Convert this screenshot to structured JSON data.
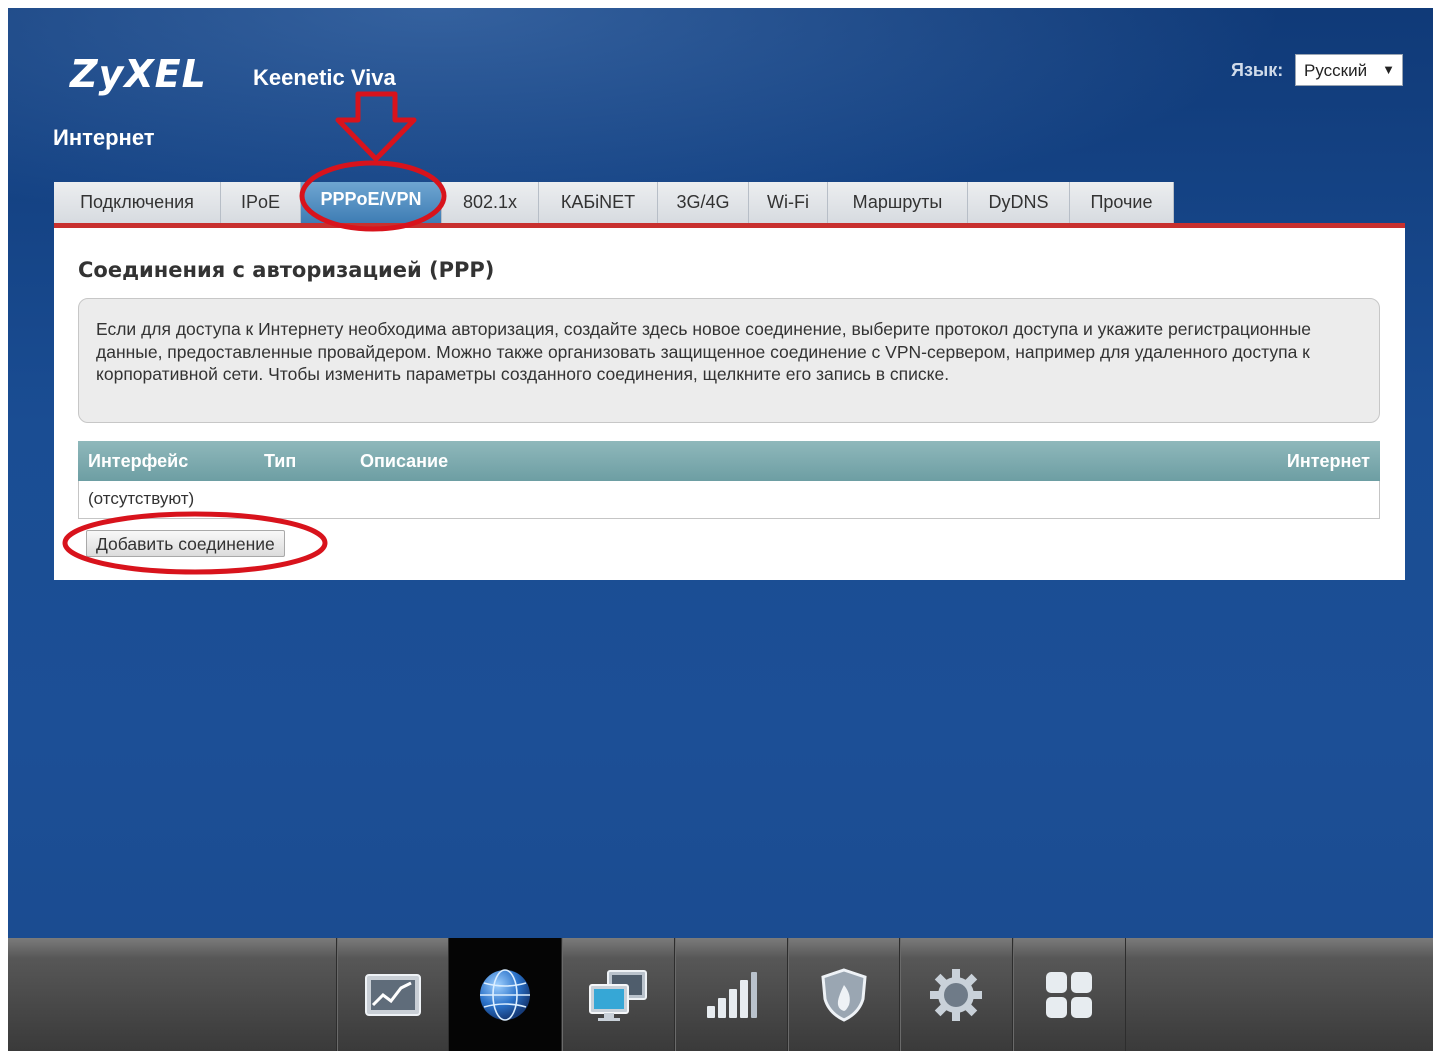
{
  "header": {
    "logo": "ZyXEL",
    "model": "Keenetic Viva",
    "page_title": "Интернет",
    "language_label": "Язык:",
    "language_value": "Русский",
    "language_arrow": "▼"
  },
  "tabs": [
    {
      "label": "Подключения",
      "active": false
    },
    {
      "label": "IPoE",
      "active": false
    },
    {
      "label": "PPPoE/VPN",
      "active": true
    },
    {
      "label": "802.1x",
      "active": false
    },
    {
      "label": "КАБiNET",
      "active": false
    },
    {
      "label": "3G/4G",
      "active": false
    },
    {
      "label": "Wi-Fi",
      "active": false
    },
    {
      "label": "Маршруты",
      "active": false
    },
    {
      "label": "DyDNS",
      "active": false
    },
    {
      "label": "Прочие",
      "active": false
    }
  ],
  "section": {
    "title": "Соединения с авторизацией (PPP)",
    "info": "Если для доступа к Интернету необходима авторизация, создайте здесь новое соединение, выберите протокол доступа и укажите регистрационные данные, предоставленные провайдером. Можно также организовать защищенное соединение с VPN-сервером, например для удаленного доступа к корпоративной сети. Чтобы изменить параметры созданного соединения, щелкните его запись в списке."
  },
  "table": {
    "columns": [
      "Интерфейс",
      "Тип",
      "Описание",
      "Интернет"
    ],
    "empty_text": "(отсутствуют)"
  },
  "add_button_label": "Добавить соединение",
  "dock": [
    {
      "icon": "monitor-chart-icon",
      "active": false
    },
    {
      "icon": "globe-icon",
      "active": true
    },
    {
      "icon": "network-computers-icon",
      "active": false
    },
    {
      "icon": "signal-bars-icon",
      "active": false
    },
    {
      "icon": "shield-icon",
      "active": false
    },
    {
      "icon": "gear-icon",
      "active": false
    },
    {
      "icon": "apps-grid-icon",
      "active": false
    }
  ],
  "colors": {
    "background": "#1c4f96",
    "active_tab": "#3e7db4",
    "tab_underline": "#c8302e",
    "table_header": "#6d9ea3",
    "annotation": "#d8131c"
  }
}
